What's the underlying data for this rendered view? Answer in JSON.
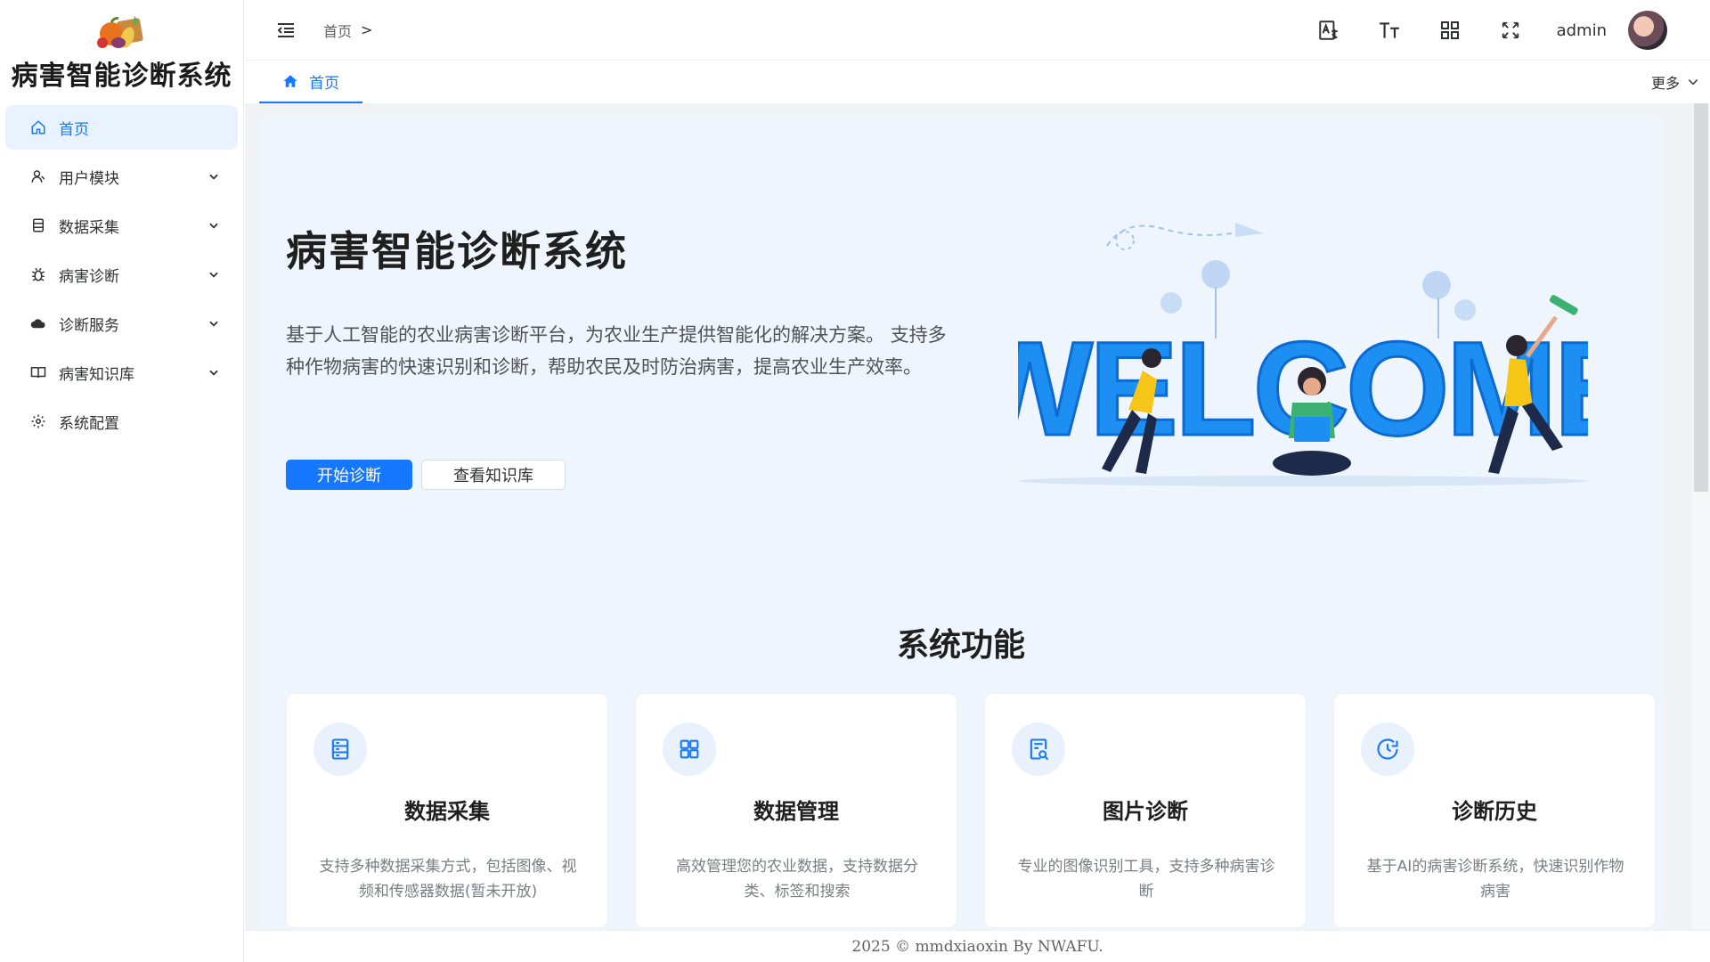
{
  "app": {
    "title": "病害智能诊断系统"
  },
  "sidebar": {
    "items": [
      {
        "label": "首页",
        "icon": "home-icon",
        "active": true
      },
      {
        "label": "用户模块",
        "icon": "user-icon",
        "expandable": true
      },
      {
        "label": "数据采集",
        "icon": "document-icon",
        "expandable": true
      },
      {
        "label": "病害诊断",
        "icon": "bug-icon",
        "expandable": true
      },
      {
        "label": "诊断服务",
        "icon": "cloud-icon",
        "expandable": true
      },
      {
        "label": "病害知识库",
        "icon": "book-icon",
        "expandable": true
      },
      {
        "label": "系统配置",
        "icon": "gear-icon",
        "expandable": false
      }
    ]
  },
  "header": {
    "breadcrumb": "首页",
    "breadcrumb_sep": ">",
    "username": "admin",
    "icons": [
      "translate-icon",
      "font-size-icon",
      "layout-grid-icon",
      "fullscreen-icon"
    ]
  },
  "tabs": {
    "items": [
      {
        "label": "首页",
        "icon": "home-icon"
      }
    ],
    "more": "更多"
  },
  "hero": {
    "title": "病害智能诊断系统",
    "description": "基于人工智能的农业病害诊断平台，为农业生产提供智能化的解决方案。 支持多种作物病害的快速识别和诊断，帮助农民及时防治病害，提高农业生产效率。",
    "primary_button": "开始诊断",
    "secondary_button": "查看知识库",
    "illustration_text": "WELCOME"
  },
  "features": {
    "title": "系统功能",
    "cards": [
      {
        "title": "数据采集",
        "desc": "支持多种数据采集方式，包括图像、视频和传感器数据(暂未开放)",
        "icon": "server-icon"
      },
      {
        "title": "数据管理",
        "desc": "高效管理您的农业数据，支持数据分类、标签和搜索",
        "icon": "grid-icon"
      },
      {
        "title": "图片诊断",
        "desc": "专业的图像识别工具，支持多种病害诊断",
        "icon": "document-search-icon"
      },
      {
        "title": "诊断历史",
        "desc": "基于AI的病害诊断系统，快速识别作物病害",
        "icon": "clock-icon"
      }
    ]
  },
  "footer": {
    "text": "2025 © mmdxiaoxin By NWAFU."
  },
  "colors": {
    "primary": "#1677ff",
    "active_bg": "#e8f3ff",
    "panel_bg": "#eff5fc",
    "accent_yellow": "#f5c518"
  }
}
